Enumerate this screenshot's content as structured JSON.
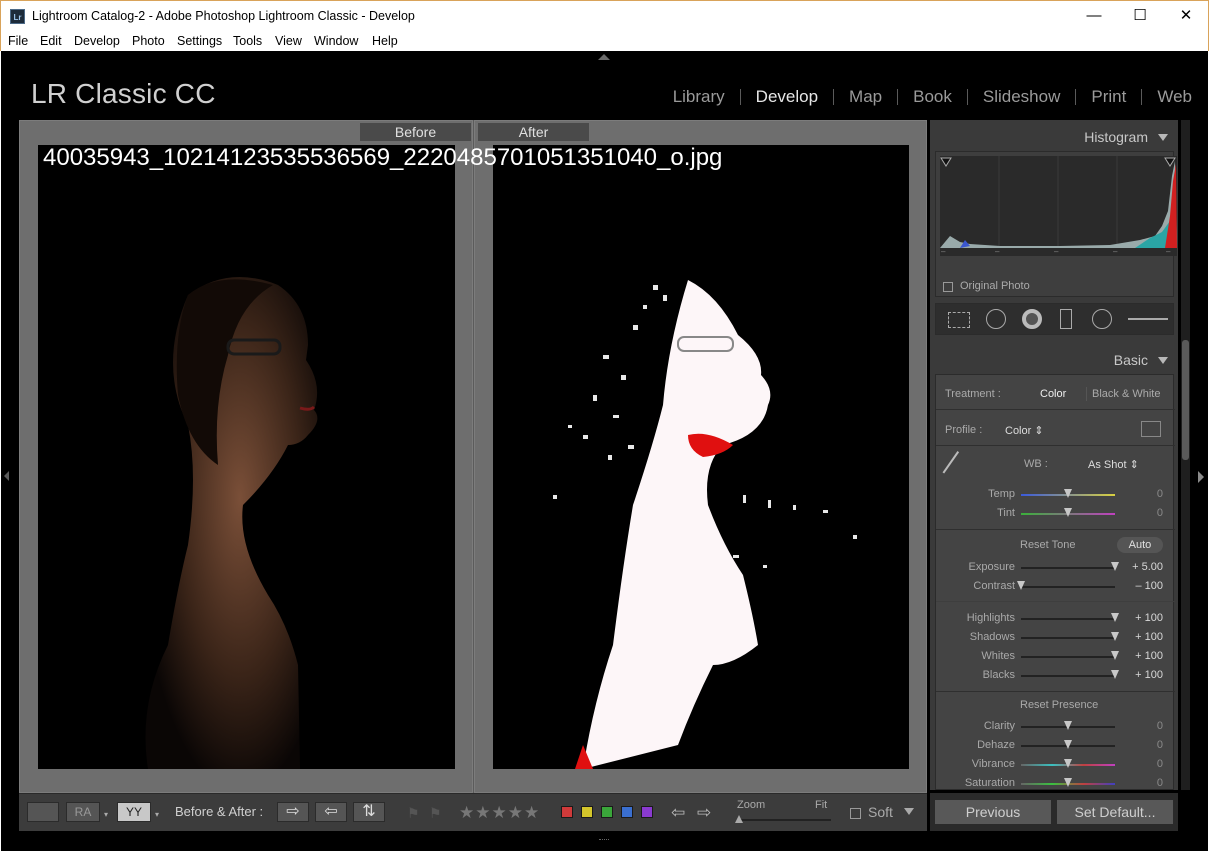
{
  "window": {
    "title": "Lightroom Catalog-2 - Adobe Photoshop Lightroom Classic - Develop",
    "app_badge": "Lr",
    "minimize": "—",
    "maximize": "☐",
    "close": "✕"
  },
  "menubar": [
    "File",
    "Edit",
    "Develop",
    "Photo",
    "Settings",
    "Tools",
    "View",
    "Window",
    "Help"
  ],
  "identity_plate": "LR Classic CC",
  "modules": [
    "Library",
    "Develop",
    "Map",
    "Book",
    "Slideshow",
    "Print",
    "Web"
  ],
  "active_module": "Develop",
  "view": {
    "before_label": "Before",
    "after_label": "After",
    "filename": "40035943_10214123535536569_2220485701051351040_o.jpg"
  },
  "right_panel": {
    "histogram_title": "Histogram",
    "original_photo_label": "Original Photo",
    "basic_title": "Basic",
    "treatment_label": "Treatment :",
    "treatment_color": "Color",
    "treatment_bw": "Black & White",
    "profile_label": "Profile :",
    "profile_value": "Color ⇕",
    "wb_label": "WB :",
    "wb_value": "As Shot ⇕",
    "reset_tone": "Reset Tone",
    "auto": "Auto",
    "reset_presence": "Reset Presence",
    "sliders": {
      "temp": {
        "name": "Temp",
        "value": "0",
        "pos": 0.5
      },
      "tint": {
        "name": "Tint",
        "value": "0",
        "pos": 0.5
      },
      "exposure": {
        "name": "Exposure",
        "value": "+ 5.00",
        "pos": 1.0
      },
      "contrast": {
        "name": "Contrast",
        "value": "– 100",
        "pos": 0.0
      },
      "highlights": {
        "name": "Highlights",
        "value": "+ 100",
        "pos": 1.0
      },
      "shadows": {
        "name": "Shadows",
        "value": "+ 100",
        "pos": 1.0
      },
      "whites": {
        "name": "Whites",
        "value": "+ 100",
        "pos": 1.0
      },
      "blacks": {
        "name": "Blacks",
        "value": "+ 100",
        "pos": 1.0
      },
      "clarity": {
        "name": "Clarity",
        "value": "0",
        "pos": 0.5
      },
      "dehaze": {
        "name": "Dehaze",
        "value": "0",
        "pos": 0.5
      },
      "vibrance": {
        "name": "Vibrance",
        "value": "0",
        "pos": 0.5
      },
      "saturation": {
        "name": "Saturation",
        "value": "0",
        "pos": 0.5
      }
    }
  },
  "toolbar": {
    "before_after_label": "Before & After :",
    "zoom_label": "Zoom",
    "fit_label": "Fit",
    "soft_label": "Soft",
    "stars": "★★★★★",
    "color_labels": [
      "#d03a3a",
      "#d4c62b",
      "#3aa63a",
      "#3a6fd0",
      "#8a3ad0"
    ],
    "ra_label": "RA",
    "yy_label": "YY"
  },
  "buttons": {
    "previous": "Previous",
    "set_default": "Set Default..."
  }
}
